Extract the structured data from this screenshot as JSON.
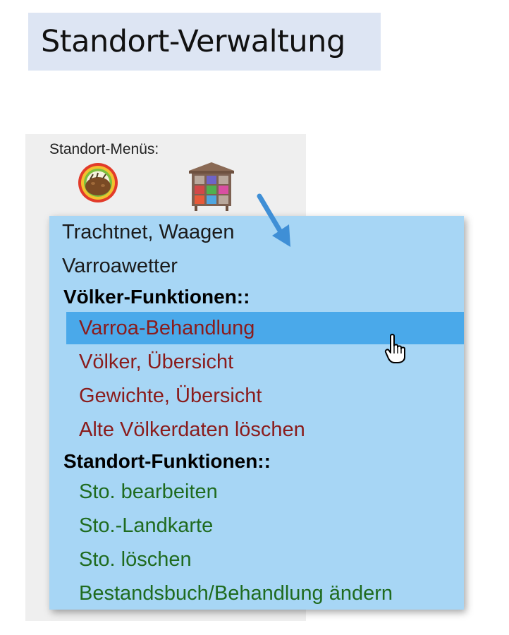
{
  "header": {
    "title": "Standort-Verwaltung"
  },
  "panel": {
    "label": "Standort-Menüs:"
  },
  "icons": {
    "bee": "bee-colony-icon",
    "hive": "beehive-icon",
    "arrow": "arrow-down-right-icon",
    "cursor": "hand-pointer-icon"
  },
  "menu": {
    "items": [
      {
        "label": "Trachtnet, Waagen",
        "style": "plain"
      },
      {
        "label": "Varroawetter",
        "style": "plain"
      },
      {
        "label": "Völker-Funktionen::",
        "style": "header"
      },
      {
        "label": "Varroa-Behandlung",
        "style": "red",
        "hovered": true
      },
      {
        "label": "Völker, Übersicht",
        "style": "red"
      },
      {
        "label": "Gewichte, Übersicht",
        "style": "red"
      },
      {
        "label": "Alte Völkerdaten löschen",
        "style": "red"
      },
      {
        "label": "Standort-Funktionen::",
        "style": "header"
      },
      {
        "label": "Sto. bearbeiten",
        "style": "green"
      },
      {
        "label": "Sto.-Landkarte",
        "style": "green"
      },
      {
        "label": "Sto. löschen",
        "style": "green"
      },
      {
        "label": "Bestandsbuch/Behandlung ändern",
        "style": "green"
      }
    ]
  },
  "colors": {
    "title_bg": "#dde5f3",
    "menu_bg": "#a7d6f5",
    "hover_bg": "#4aa9ea",
    "red_text": "#8a1c1c",
    "green_text": "#1f6b1f"
  }
}
